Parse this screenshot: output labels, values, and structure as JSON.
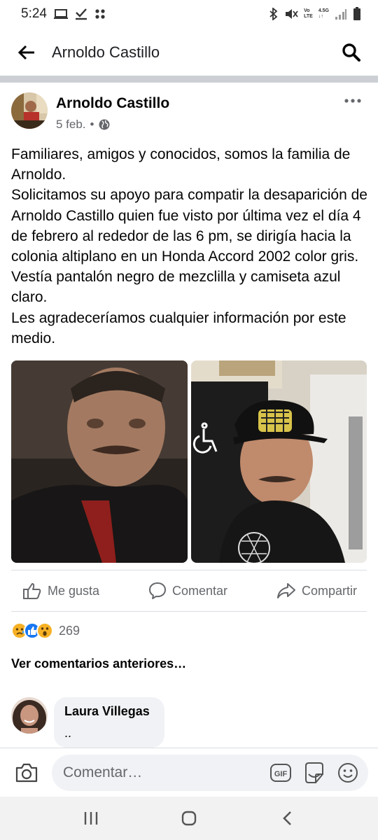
{
  "status_bar": {
    "time": "5:24",
    "left_icons": [
      "screen-icon",
      "download-check-icon",
      "dots-grid-icon"
    ],
    "right_icons": [
      "bluetooth-icon",
      "mute-icon",
      "volte-lte-icon",
      "4g-icon",
      "signal-icon",
      "battery-icon"
    ],
    "volte_top": "Vo",
    "volte_bottom": "LTE",
    "network": "4.5G"
  },
  "header": {
    "title": "Arnoldo Castillo",
    "back_icon": "back-arrow-icon",
    "search_icon": "search-icon"
  },
  "post": {
    "author": "Arnoldo Castillo",
    "date": "5 feb.",
    "separator": "•",
    "privacy_icon": "globe-icon",
    "text_lines": [
      "Familiares, amigos y conocidos, somos la familia de Arnoldo.",
      "Solicitamos su apoyo para compatir la desaparición de Arnoldo Castillo quien fue visto por última vez el día 4 de febrero al rededor de las 6 pm, se dirigía hacia la colonia altiplano en un Honda Accord 2002 color gris. Vestía pantalón negro de mezclilla y camiseta azul claro.",
      "Les agradeceríamos cualquier información por este medio."
    ]
  },
  "actions": {
    "like": "Me gusta",
    "comment": "Comentar",
    "share": "Compartir"
  },
  "reactions": {
    "icons": [
      "sad-icon",
      "like-icon",
      "wow-icon"
    ],
    "count": "269"
  },
  "comments": {
    "more_label": "Ver comentarios anteriores…",
    "items": [
      {
        "author": "Laura Villegas",
        "text": ".."
      }
    ]
  },
  "composer": {
    "placeholder": "Comentar…",
    "gif_label": "GIF"
  },
  "colors": {
    "text": "#050505",
    "secondary": "#65676b",
    "divider": "#ccd0d5",
    "input_bg": "#f0f2f5",
    "like_blue": "#1877f2",
    "reaction_yellow": "#f7b125"
  }
}
